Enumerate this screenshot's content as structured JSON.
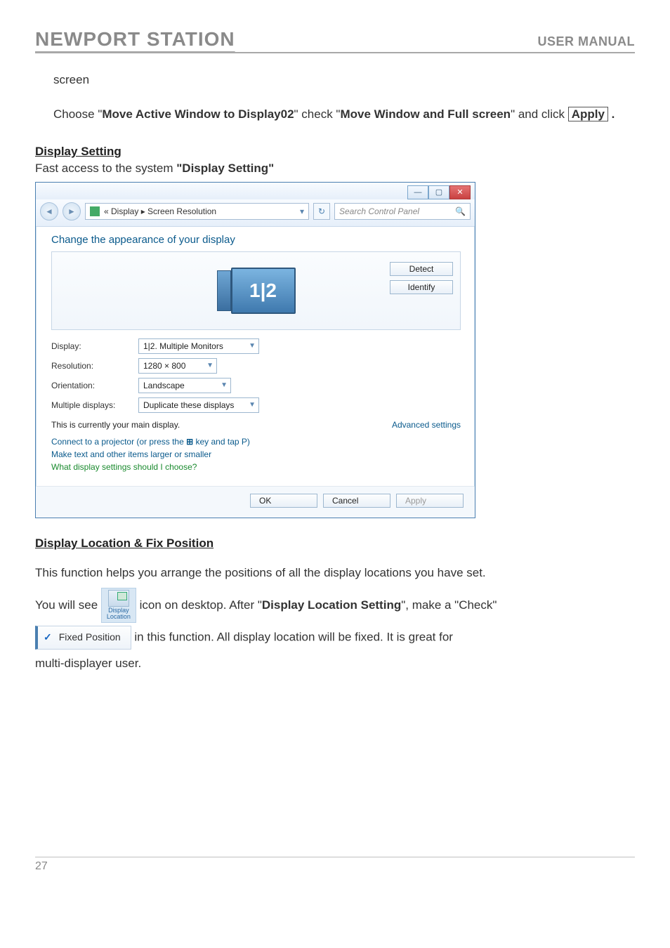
{
  "header": {
    "left": "NEWPORT STATION",
    "right": "USER MANUAL"
  },
  "para1": "screen",
  "para2_a": "Choose \"",
  "para2_b": "Move Active Window to Display02",
  "para2_c": "\" check \"",
  "para2_d": "Move Window and Full screen",
  "para2_e": "\" and click ",
  "apply_kbd": "Apply",
  "period": " .",
  "section_display_setting": "Display Setting",
  "fast_access_a": "Fast access to the system ",
  "fast_access_b": "\"Display Setting\"",
  "win": {
    "breadcrumb_a": "«  Display  ▸  Screen Resolution",
    "search_ph": "Search Control Panel",
    "title": "Change the appearance of your display",
    "detect": "Detect",
    "identify": "Identify",
    "mon_label": "1|2",
    "rows": {
      "display_lbl": "Display:",
      "display_val": "1|2. Multiple Monitors",
      "res_lbl": "Resolution:",
      "res_val": "1280 × 800",
      "orient_lbl": "Orientation:",
      "orient_val": "Landscape",
      "multi_lbl": "Multiple displays:",
      "multi_val": "Duplicate these displays"
    },
    "main_msg": "This is currently your main display.",
    "adv": "Advanced settings",
    "proj_a": "Connect to a projector (or press the ",
    "proj_b": " key and tap P)",
    "larger": "Make text and other items larger or smaller",
    "what": "What display settings should I choose?",
    "ok": "OK",
    "cancel": "Cancel",
    "apply": "Apply"
  },
  "section_display_loc": "Display Location & Fix Position",
  "loc_intro": "This function helps you arrange the positions of all the display locations you have set.",
  "deskicon_label": "Display Location",
  "loc_line_a": "You will see ",
  "loc_line_b": "icon on desktop. After \"",
  "loc_line_c": "Display Location Setting",
  "loc_line_d": "\", make a \"Check\"",
  "fixed_position": "Fixed Position",
  "loc_tail": "in this function. All display location will be fixed. It is great for",
  "loc_last": "multi-displayer user.",
  "pagenum": "27"
}
